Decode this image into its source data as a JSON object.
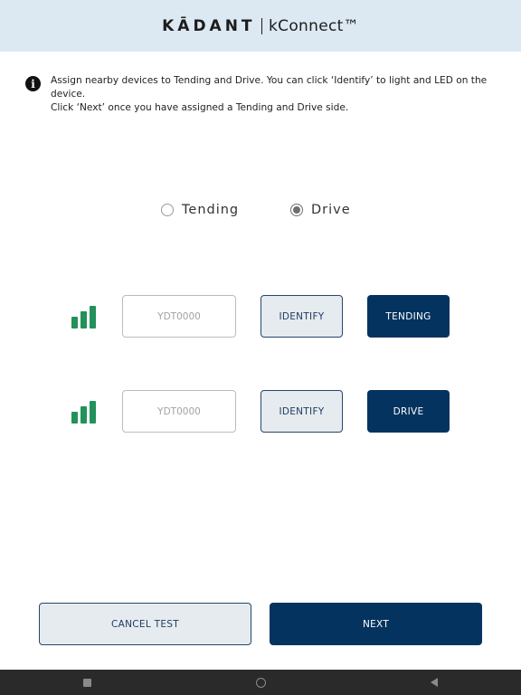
{
  "header": {
    "brand_name": "KĀDANT",
    "product_name": "kConnect™"
  },
  "info": {
    "line1": "Assign nearby devices to Tending and Drive. You can click ‘Identify’ to light and LED on the device.",
    "line2": "Click ‘Next’ once you have assigned a Tending and Drive side."
  },
  "side_selector": {
    "options": [
      {
        "label": "Tending",
        "checked": false
      },
      {
        "label": "Drive",
        "checked": true
      }
    ]
  },
  "devices": [
    {
      "placeholder": "YDT0000",
      "identify_label": "IDENTIFY",
      "side_label": "TENDING",
      "signal_bars": 3
    },
    {
      "placeholder": "YDT0000",
      "identify_label": "IDENTIFY",
      "side_label": "DRIVE",
      "signal_bars": 3
    }
  ],
  "footer": {
    "cancel_label": "CANCEL TEST",
    "next_label": "NEXT"
  },
  "icons": {
    "info": "info-icon",
    "signal": "signal-strength-icon",
    "nav_recents": "square-icon",
    "nav_home": "circle-icon",
    "nav_back": "back-triangle-icon"
  },
  "colors": {
    "header_bg": "#dce8f2",
    "primary": "#04335f",
    "secondary_bg": "#e5ebef",
    "signal": "#22915a"
  }
}
